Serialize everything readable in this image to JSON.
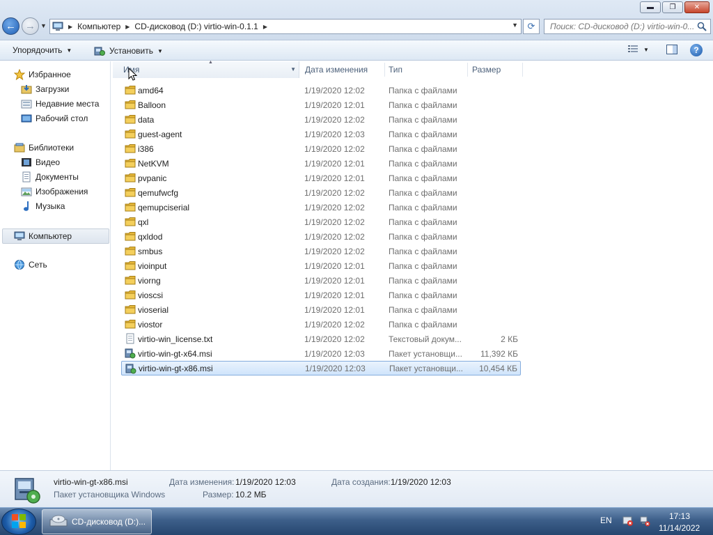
{
  "window": {
    "controls": {
      "minimize": "▬",
      "maximize": "❐",
      "close": "✕"
    }
  },
  "nav": {
    "back_icon": "←",
    "forward_icon": "→",
    "dropdown_icon": "▼"
  },
  "address": {
    "crumbs": [
      "Компьютер",
      "CD-дисковод (D:) virtio-win-0.1.1"
    ],
    "separator": "▶",
    "dropdown_icon": "▼"
  },
  "search": {
    "placeholder": "Поиск: CD-дисковод (D:) virtio-win-0..."
  },
  "toolbar": {
    "organize_label": "Упорядочить",
    "install_label": "Установить",
    "dropdown_icon": "▼",
    "help_label": "?"
  },
  "sidebar": {
    "favorites": {
      "label": "Избранное",
      "items": [
        {
          "label": "Загрузки",
          "icon": "downloads-icon"
        },
        {
          "label": "Недавние места",
          "icon": "recent-places-icon"
        },
        {
          "label": "Рабочий стол",
          "icon": "desktop-icon"
        }
      ]
    },
    "libraries": {
      "label": "Библиотеки",
      "items": [
        {
          "label": "Видео",
          "icon": "video-icon"
        },
        {
          "label": "Документы",
          "icon": "documents-icon"
        },
        {
          "label": "Изображения",
          "icon": "pictures-icon"
        },
        {
          "label": "Музыка",
          "icon": "music-icon"
        }
      ]
    },
    "computer": {
      "label": "Компьютер"
    },
    "network": {
      "label": "Сеть"
    }
  },
  "columns": {
    "name": "Имя",
    "date": "Дата изменения",
    "type": "Тип",
    "size": "Размер"
  },
  "files": [
    {
      "name": "amd64",
      "date": "1/19/2020 12:02",
      "type": "Папка с файлами",
      "size": "",
      "kind": "folder"
    },
    {
      "name": "Balloon",
      "date": "1/19/2020 12:01",
      "type": "Папка с файлами",
      "size": "",
      "kind": "folder"
    },
    {
      "name": "data",
      "date": "1/19/2020 12:02",
      "type": "Папка с файлами",
      "size": "",
      "kind": "folder"
    },
    {
      "name": "guest-agent",
      "date": "1/19/2020 12:03",
      "type": "Папка с файлами",
      "size": "",
      "kind": "folder"
    },
    {
      "name": "i386",
      "date": "1/19/2020 12:02",
      "type": "Папка с файлами",
      "size": "",
      "kind": "folder"
    },
    {
      "name": "NetKVM",
      "date": "1/19/2020 12:01",
      "type": "Папка с файлами",
      "size": "",
      "kind": "folder"
    },
    {
      "name": "pvpanic",
      "date": "1/19/2020 12:01",
      "type": "Папка с файлами",
      "size": "",
      "kind": "folder"
    },
    {
      "name": "qemufwcfg",
      "date": "1/19/2020 12:02",
      "type": "Папка с файлами",
      "size": "",
      "kind": "folder"
    },
    {
      "name": "qemupciserial",
      "date": "1/19/2020 12:02",
      "type": "Папка с файлами",
      "size": "",
      "kind": "folder"
    },
    {
      "name": "qxl",
      "date": "1/19/2020 12:02",
      "type": "Папка с файлами",
      "size": "",
      "kind": "folder"
    },
    {
      "name": "qxldod",
      "date": "1/19/2020 12:02",
      "type": "Папка с файлами",
      "size": "",
      "kind": "folder"
    },
    {
      "name": "smbus",
      "date": "1/19/2020 12:02",
      "type": "Папка с файлами",
      "size": "",
      "kind": "folder"
    },
    {
      "name": "vioinput",
      "date": "1/19/2020 12:01",
      "type": "Папка с файлами",
      "size": "",
      "kind": "folder"
    },
    {
      "name": "viorng",
      "date": "1/19/2020 12:01",
      "type": "Папка с файлами",
      "size": "",
      "kind": "folder"
    },
    {
      "name": "vioscsi",
      "date": "1/19/2020 12:01",
      "type": "Папка с файлами",
      "size": "",
      "kind": "folder"
    },
    {
      "name": "vioserial",
      "date": "1/19/2020 12:01",
      "type": "Папка с файлами",
      "size": "",
      "kind": "folder"
    },
    {
      "name": "viostor",
      "date": "1/19/2020 12:02",
      "type": "Папка с файлами",
      "size": "",
      "kind": "folder"
    },
    {
      "name": "virtio-win_license.txt",
      "date": "1/19/2020 12:02",
      "type": "Текстовый докум...",
      "size": "2 КБ",
      "kind": "text"
    },
    {
      "name": "virtio-win-gt-x64.msi",
      "date": "1/19/2020 12:03",
      "type": "Пакет установщи...",
      "size": "11,392 КБ",
      "kind": "msi"
    },
    {
      "name": "virtio-win-gt-x86.msi",
      "date": "1/19/2020 12:03",
      "type": "Пакет установщи...",
      "size": "10,454 КБ",
      "kind": "msi",
      "selected": true
    }
  ],
  "details": {
    "filename": "virtio-win-gt-x86.msi",
    "filetype": "Пакет установщика Windows",
    "modified_label": "Дата изменения:",
    "modified_value": "1/19/2020 12:03",
    "created_label": "Дата создания:",
    "created_value": "1/19/2020 12:03",
    "size_label": "Размер:",
    "size_value": "10.2 МБ"
  },
  "taskbar": {
    "task_label": "CD-дисковод (D:)...",
    "language": "EN",
    "time": "17:13",
    "date": "11/14/2022"
  },
  "colors": {
    "folder": "#f2c94c",
    "selection": "#cfe4fb",
    "accent": "#1f5fb5"
  }
}
